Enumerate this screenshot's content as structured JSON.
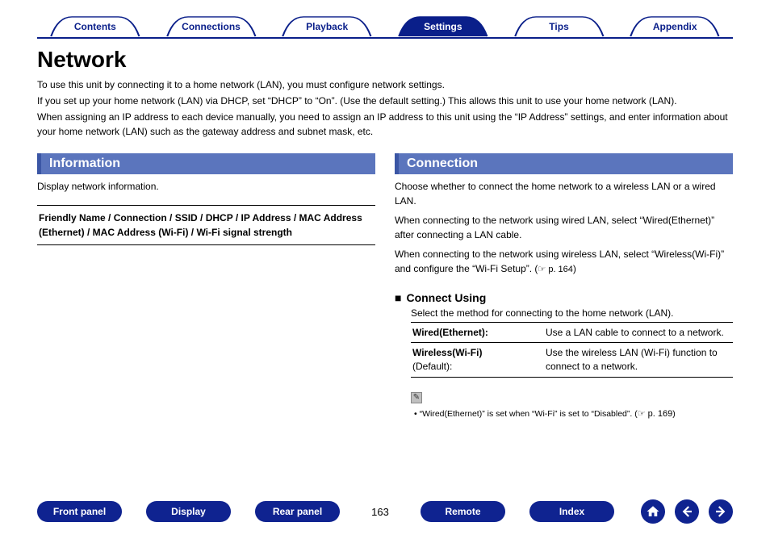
{
  "tabs": [
    "Contents",
    "Connections",
    "Playback",
    "Settings",
    "Tips",
    "Appendix"
  ],
  "active_tab": 3,
  "title": "Network",
  "intro": [
    "To use this unit by connecting it to a home network (LAN), you must configure network settings.",
    "If you set up your home network (LAN) via DHCP, set “DHCP” to “On”. (Use the default setting.) This allows this unit to use your home network (LAN).",
    "When assigning an IP address to each device manually, you need to assign an IP address to this unit using the “IP Address” settings, and enter information about your home network (LAN) such as the gateway address and subnet mask, etc."
  ],
  "left": {
    "heading": "Information",
    "desc": "Display network information.",
    "fields": "Friendly Name / Connection / SSID / DHCP / IP Address / MAC Address (Ethernet) / MAC Address (Wi-Fi) / Wi-Fi signal strength"
  },
  "right": {
    "heading": "Connection",
    "p1": "Choose whether to connect the home network to a wireless LAN or a wired LAN.",
    "p2": "When connecting to the network using wired LAN, select “Wired(Ethernet)” after connecting a LAN cable.",
    "p3a": "When connecting to the network using wireless LAN, select “Wireless(Wi-Fi)” and configure the “Wi-Fi Setup”. (",
    "p3ref": "☞ p. 164",
    "p3b": ")",
    "sub_heading": "Connect Using",
    "sub_desc": "Select the method for connecting to the home network (LAN).",
    "options": [
      {
        "label": "Wired(Ethernet):",
        "default": "",
        "desc": "Use a LAN cable to connect to a network."
      },
      {
        "label": "Wireless(Wi-Fi)",
        "default": "(Default):",
        "desc": "Use the wireless LAN (Wi-Fi) function to connect to a network."
      }
    ],
    "note_a": "• “Wired(Ethernet)” is set when “Wi-Fi” is set to “Disabled”.  (",
    "note_ref": "☞ p. 169",
    "note_b": ")"
  },
  "footer": {
    "buttons": [
      "Front panel",
      "Display",
      "Rear panel"
    ],
    "page": "163",
    "buttons2": [
      "Remote",
      "Index"
    ]
  }
}
